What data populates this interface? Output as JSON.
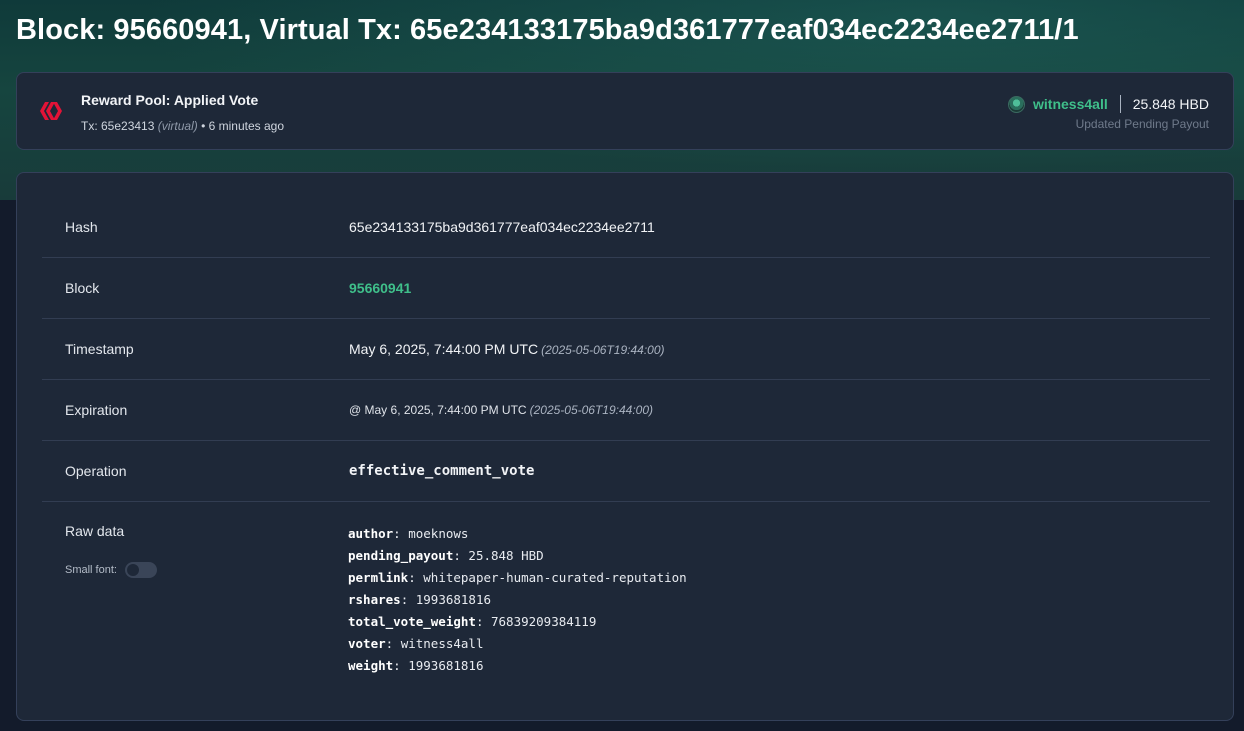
{
  "page": {
    "title": "Block: 95660941, Virtual Tx: 65e234133175ba9d361777eaf034ec2234ee2711/1"
  },
  "summary": {
    "op_title": "Reward Pool: Applied Vote",
    "tx_prefix": "Tx: 65e23413",
    "virtual_tag": "(virtual)",
    "bullet": "•",
    "time_ago": "6 minutes ago",
    "voter": "witness4all",
    "payout": "25.848 HBD",
    "payout_caption": "Updated Pending Payout"
  },
  "details": {
    "hash": {
      "label": "Hash",
      "value": "65e234133175ba9d361777eaf034ec2234ee2711"
    },
    "block": {
      "label": "Block",
      "value": "95660941"
    },
    "timestamp": {
      "label": "Timestamp",
      "value": "May 6, 2025, 7:44:00 PM UTC",
      "iso": "(2025-05-06T19:44:00)"
    },
    "expiration": {
      "label": "Expiration",
      "value": "@ May 6, 2025, 7:44:00 PM UTC",
      "iso": "(2025-05-06T19:44:00)"
    },
    "operation": {
      "label": "Operation",
      "value": "effective_comment_vote"
    }
  },
  "raw": {
    "label": "Raw data",
    "small_font_label": "Small font:",
    "small_font_enabled": false,
    "fields": [
      {
        "key": "author",
        "value": "moeknows"
      },
      {
        "key": "pending_payout",
        "value": "25.848 HBD"
      },
      {
        "key": "permlink",
        "value": "whitepaper-human-curated-reputation"
      },
      {
        "key": "rshares",
        "value": "1993681816"
      },
      {
        "key": "total_vote_weight",
        "value": "76839209384119"
      },
      {
        "key": "voter",
        "value": "witness4all"
      },
      {
        "key": "weight",
        "value": "1993681816"
      }
    ]
  },
  "colors": {
    "accent_green": "#3fbf8a",
    "hive_red": "#e31337",
    "card_bg": "#1e2838",
    "page_bg": "#131b2b"
  },
  "icons": {
    "logo": "hive-logo-icon",
    "avatar": "voter-avatar"
  }
}
